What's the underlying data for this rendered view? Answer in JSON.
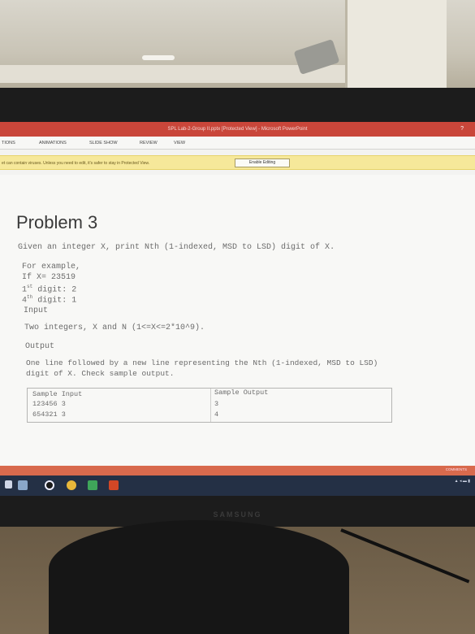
{
  "window": {
    "title": "SPL Lab-2-Group II.pptx [Protected View] - Microsoft PowerPoint",
    "help": "?"
  },
  "ribbon": {
    "tabs": [
      "TIONS",
      "ANIMATIONS",
      "SLIDE SHOW",
      "REVIEW",
      "VIEW"
    ]
  },
  "protected_view": {
    "message": "et can contain viruses. Unless you need to edit, it's safer to stay in Protected View.",
    "button": "Enable Editing"
  },
  "slide": {
    "title": "Problem 3",
    "statement": "Given an integer X, print Nth (1-indexed, MSD to LSD) digit of X.",
    "example_heading": "For example,",
    "example_x": "If X= 23519",
    "digit1_num": "1",
    "digit1_sup": "st",
    "digit1_rest": " digit: 2",
    "digit4_num": "4",
    "digit4_sup": "th",
    "digit4_rest": " digit: 1",
    "input_heading": "Input",
    "input_text": "Two integers, X and N (1<=X<=2*10^9).",
    "output_heading": "Output",
    "output_line1": "One line followed by a new line representing the Nth (1-indexed, MSD to LSD)",
    "output_line2": "digit of X. Check sample output.",
    "sample": {
      "input_header": "Sample Input",
      "output_header": "Sample Output",
      "rows": [
        {
          "input": "123456 3",
          "output": "3"
        },
        {
          "input": "654321 3",
          "output": "4"
        }
      ]
    }
  },
  "statusbar": {
    "comments": "COMMENTS"
  },
  "taskbar": {
    "icons": [
      "start-icon",
      "file-explorer-icon",
      "media-player-icon",
      "chrome-icon",
      "store-icon",
      "powerpoint-icon"
    ],
    "colors": {
      "bar": "#243045",
      "powerpoint": "#d24726",
      "chrome": "#e8b73a",
      "store": "#3fa55a"
    }
  },
  "monitor": {
    "brand": "SAMSUNG"
  }
}
